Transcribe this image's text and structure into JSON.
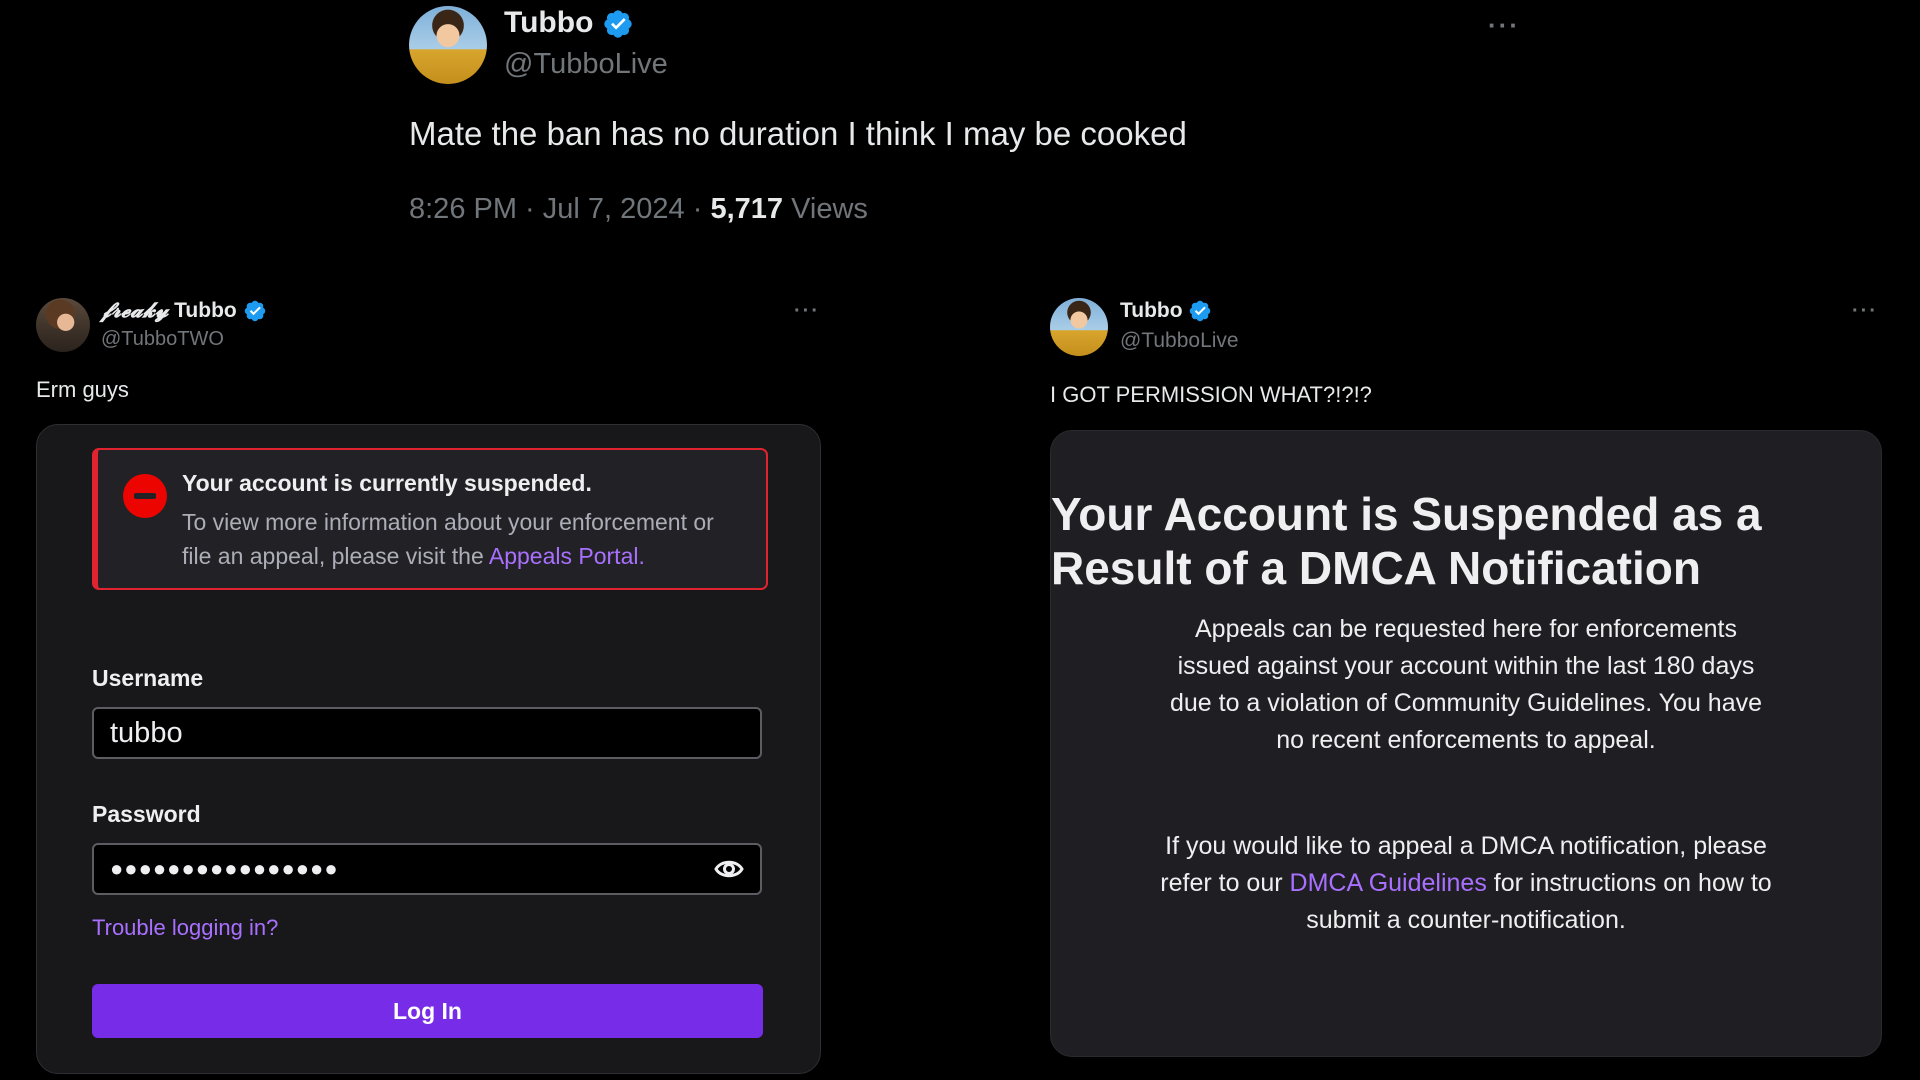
{
  "top_tweet": {
    "name": "Tubbo",
    "handle": "@TubboLive",
    "text": "Mate the ban has no duration I think I may be cooked",
    "time": "8:26 PM · Jul 7, 2024 · ",
    "views_count": "5,717",
    "views_label": " Views",
    "more_icon": "more-horizontal-icon"
  },
  "left_tweet": {
    "name_prefix": "𝓯𝓻𝓮𝓪𝓴𝔂",
    "name": "Tubbo",
    "handle": "@TubboTWO",
    "text": "Erm guys",
    "more_icon": "more-horizontal-icon",
    "alert": {
      "title": "Your account is currently suspended.",
      "body": "To view more information about your enforcement or file an appeal, please visit the ",
      "link": "Appeals Portal."
    },
    "username_label": "Username",
    "username_value": "tubbo",
    "password_label": "Password",
    "password_value": "●●●●●●●●●●●●●●●●",
    "trouble_link": "Trouble logging in?",
    "login_button": "Log In",
    "colors": {
      "alert_red": "#e0242f",
      "accent_purple": "#772ce8",
      "link_purple": "#a970ff"
    }
  },
  "right_tweet": {
    "name": "Tubbo",
    "handle": "@TubboLive",
    "text": "I GOT PERMISSION WHAT?!?!?",
    "more_icon": "more-horizontal-icon",
    "title": "Your Account is Suspended as a Result of a DMCA Notification",
    "para1": "Appeals can be requested here for enforcements issued against your account within the last 180 days due to a violation of Community Guidelines. You have no recent enforcements to appeal.",
    "para2_start": "If you would like to appeal a DMCA notification, please refer to our ",
    "para2_link": "DMCA Guidelines",
    "para2_end": " for instructions on how to submit a counter-notification."
  }
}
